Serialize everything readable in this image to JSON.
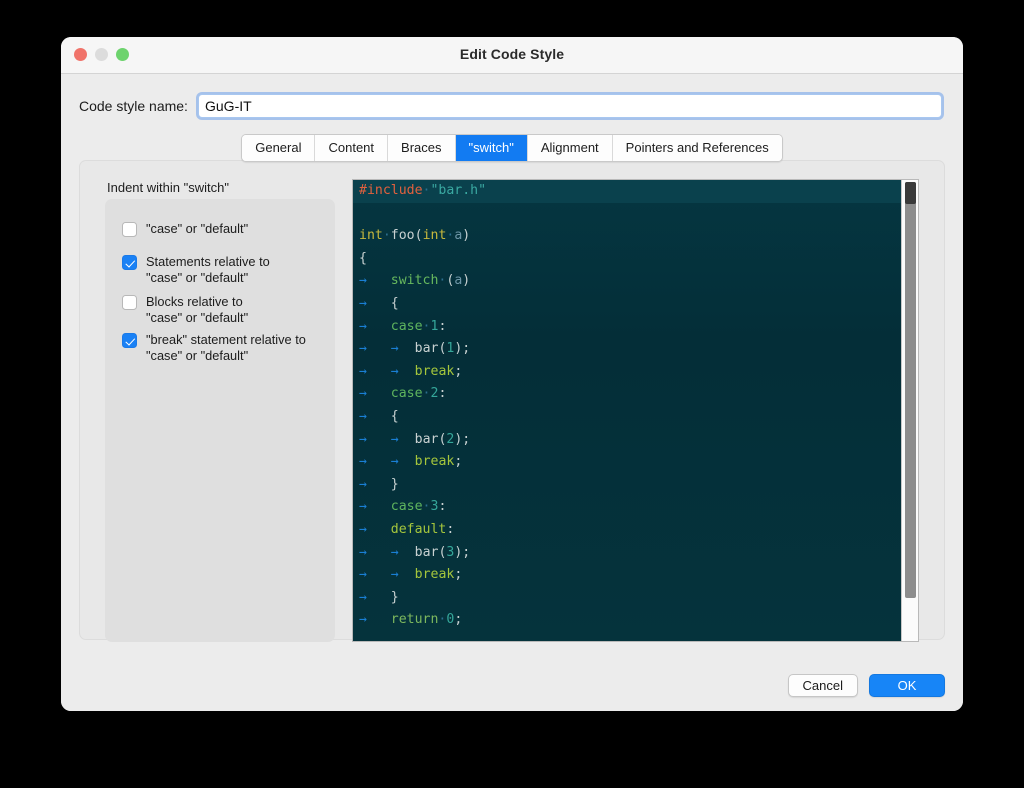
{
  "window": {
    "title": "Edit Code Style",
    "traffic_lights": [
      "close",
      "minimize",
      "zoom"
    ]
  },
  "name_field": {
    "label": "Code style name:",
    "value": "GuG-IT",
    "placeholder": "Code style name"
  },
  "tabs": [
    {
      "label": "General",
      "active": false
    },
    {
      "label": "Content",
      "active": false
    },
    {
      "label": "Braces",
      "active": false
    },
    {
      "label": "\"switch\"",
      "active": true
    },
    {
      "label": "Alignment",
      "active": false
    },
    {
      "label": "Pointers and References",
      "active": false
    }
  ],
  "group": {
    "title": "Indent within \"switch\"",
    "options": [
      {
        "label": "\"case\" or \"default\"",
        "checked": false
      },
      {
        "label": "Statements relative to\n\"case\" or \"default\"",
        "checked": true
      },
      {
        "label": "Blocks relative to\n\"case\" or \"default\"",
        "checked": false
      },
      {
        "label": "\"break\" statement relative to\n\"case\" or \"default\"",
        "checked": true
      }
    ]
  },
  "preview": {
    "lines": [
      {
        "highlight": true,
        "tokens": [
          {
            "t": "#include",
            "c": "k-inc"
          },
          {
            "t": "·",
            "c": "dot"
          },
          {
            "t": "\"bar.h\"",
            "c": "k-str"
          }
        ]
      },
      {
        "highlight": false,
        "tokens": []
      },
      {
        "highlight": false,
        "tokens": [
          {
            "t": "int",
            "c": "k-type"
          },
          {
            "t": "·",
            "c": "dot"
          },
          {
            "t": "foo",
            "c": "k-fn"
          },
          {
            "t": "(",
            "c": "k-punct"
          },
          {
            "t": "int",
            "c": "k-type"
          },
          {
            "t": "·",
            "c": "dot"
          },
          {
            "t": "a",
            "c": "k-var"
          },
          {
            "t": ")",
            "c": "k-punct"
          }
        ]
      },
      {
        "highlight": false,
        "tokens": [
          {
            "t": "{",
            "c": "k-punct"
          }
        ]
      },
      {
        "highlight": false,
        "tokens": [
          {
            "t": "→",
            "c": "tab-arrow"
          },
          {
            "t": "   ",
            "c": "k-punct"
          },
          {
            "t": "switch",
            "c": "k-kw"
          },
          {
            "t": "·",
            "c": "dot"
          },
          {
            "t": "(",
            "c": "k-punct"
          },
          {
            "t": "a",
            "c": "k-var"
          },
          {
            "t": ")",
            "c": "k-punct"
          }
        ]
      },
      {
        "highlight": false,
        "tokens": [
          {
            "t": "→",
            "c": "tab-arrow"
          },
          {
            "t": "   ",
            "c": "k-punct"
          },
          {
            "t": "{",
            "c": "k-punct"
          }
        ]
      },
      {
        "highlight": false,
        "tokens": [
          {
            "t": "→",
            "c": "tab-arrow"
          },
          {
            "t": "   ",
            "c": "k-punct"
          },
          {
            "t": "case",
            "c": "k-case"
          },
          {
            "t": "·",
            "c": "dot"
          },
          {
            "t": "1",
            "c": "k-num"
          },
          {
            "t": ":",
            "c": "k-punct"
          }
        ]
      },
      {
        "highlight": false,
        "tokens": [
          {
            "t": "→",
            "c": "tab-arrow"
          },
          {
            "t": "   ",
            "c": "k-punct"
          },
          {
            "t": "→",
            "c": "tab-arrow"
          },
          {
            "t": "  ",
            "c": "k-punct"
          },
          {
            "t": "bar",
            "c": "k-fn"
          },
          {
            "t": "(",
            "c": "k-punct"
          },
          {
            "t": "1",
            "c": "k-num"
          },
          {
            "t": ");",
            "c": "k-punct"
          }
        ]
      },
      {
        "highlight": false,
        "tokens": [
          {
            "t": "→",
            "c": "tab-arrow"
          },
          {
            "t": "   ",
            "c": "k-punct"
          },
          {
            "t": "→",
            "c": "tab-arrow"
          },
          {
            "t": "  ",
            "c": "k-punct"
          },
          {
            "t": "break",
            "c": "k-brk"
          },
          {
            "t": ";",
            "c": "k-punct"
          }
        ]
      },
      {
        "highlight": false,
        "tokens": [
          {
            "t": "→",
            "c": "tab-arrow"
          },
          {
            "t": "   ",
            "c": "k-punct"
          },
          {
            "t": "case",
            "c": "k-case"
          },
          {
            "t": "·",
            "c": "dot"
          },
          {
            "t": "2",
            "c": "k-num"
          },
          {
            "t": ":",
            "c": "k-punct"
          }
        ]
      },
      {
        "highlight": false,
        "tokens": [
          {
            "t": "→",
            "c": "tab-arrow"
          },
          {
            "t": "   ",
            "c": "k-punct"
          },
          {
            "t": "{",
            "c": "k-punct"
          }
        ]
      },
      {
        "highlight": false,
        "tokens": [
          {
            "t": "→",
            "c": "tab-arrow"
          },
          {
            "t": "   ",
            "c": "k-punct"
          },
          {
            "t": "→",
            "c": "tab-arrow"
          },
          {
            "t": "  ",
            "c": "k-punct"
          },
          {
            "t": "bar",
            "c": "k-fn"
          },
          {
            "t": "(",
            "c": "k-punct"
          },
          {
            "t": "2",
            "c": "k-num"
          },
          {
            "t": ");",
            "c": "k-punct"
          }
        ]
      },
      {
        "highlight": false,
        "tokens": [
          {
            "t": "→",
            "c": "tab-arrow"
          },
          {
            "t": "   ",
            "c": "k-punct"
          },
          {
            "t": "→",
            "c": "tab-arrow"
          },
          {
            "t": "  ",
            "c": "k-punct"
          },
          {
            "t": "break",
            "c": "k-brk"
          },
          {
            "t": ";",
            "c": "k-punct"
          }
        ]
      },
      {
        "highlight": false,
        "tokens": [
          {
            "t": "→",
            "c": "tab-arrow"
          },
          {
            "t": "   ",
            "c": "k-punct"
          },
          {
            "t": "}",
            "c": "k-punct"
          }
        ]
      },
      {
        "highlight": false,
        "tokens": [
          {
            "t": "→",
            "c": "tab-arrow"
          },
          {
            "t": "   ",
            "c": "k-punct"
          },
          {
            "t": "case",
            "c": "k-case"
          },
          {
            "t": "·",
            "c": "dot"
          },
          {
            "t": "3",
            "c": "k-num"
          },
          {
            "t": ":",
            "c": "k-punct"
          }
        ]
      },
      {
        "highlight": false,
        "tokens": [
          {
            "t": "→",
            "c": "tab-arrow"
          },
          {
            "t": "   ",
            "c": "k-punct"
          },
          {
            "t": "default",
            "c": "k-def"
          },
          {
            "t": ":",
            "c": "k-punct"
          }
        ]
      },
      {
        "highlight": false,
        "tokens": [
          {
            "t": "→",
            "c": "tab-arrow"
          },
          {
            "t": "   ",
            "c": "k-punct"
          },
          {
            "t": "→",
            "c": "tab-arrow"
          },
          {
            "t": "  ",
            "c": "k-punct"
          },
          {
            "t": "bar",
            "c": "k-fn"
          },
          {
            "t": "(",
            "c": "k-punct"
          },
          {
            "t": "3",
            "c": "k-num"
          },
          {
            "t": ");",
            "c": "k-punct"
          }
        ]
      },
      {
        "highlight": false,
        "tokens": [
          {
            "t": "→",
            "c": "tab-arrow"
          },
          {
            "t": "   ",
            "c": "k-punct"
          },
          {
            "t": "→",
            "c": "tab-arrow"
          },
          {
            "t": "  ",
            "c": "k-punct"
          },
          {
            "t": "break",
            "c": "k-brk"
          },
          {
            "t": ";",
            "c": "k-punct"
          }
        ]
      },
      {
        "highlight": false,
        "tokens": [
          {
            "t": "→",
            "c": "tab-arrow"
          },
          {
            "t": "   ",
            "c": "k-punct"
          },
          {
            "t": "}",
            "c": "k-punct"
          }
        ]
      },
      {
        "highlight": false,
        "tokens": [
          {
            "t": "→",
            "c": "tab-arrow"
          },
          {
            "t": "   ",
            "c": "k-punct"
          },
          {
            "t": "return",
            "c": "k-ret"
          },
          {
            "t": "·",
            "c": "dot"
          },
          {
            "t": "0",
            "c": "k-num"
          },
          {
            "t": ";",
            "c": "k-punct"
          }
        ]
      }
    ],
    "scrollbar": {
      "position": "top"
    }
  },
  "footer": {
    "cancel_label": "Cancel",
    "ok_label": "OK"
  },
  "colors": {
    "accent": "#127bf2",
    "primary_button": "#1785f7",
    "checkbox_checked": "#1a81f5",
    "code_background": "#042e38",
    "window_background": "#ececec"
  }
}
